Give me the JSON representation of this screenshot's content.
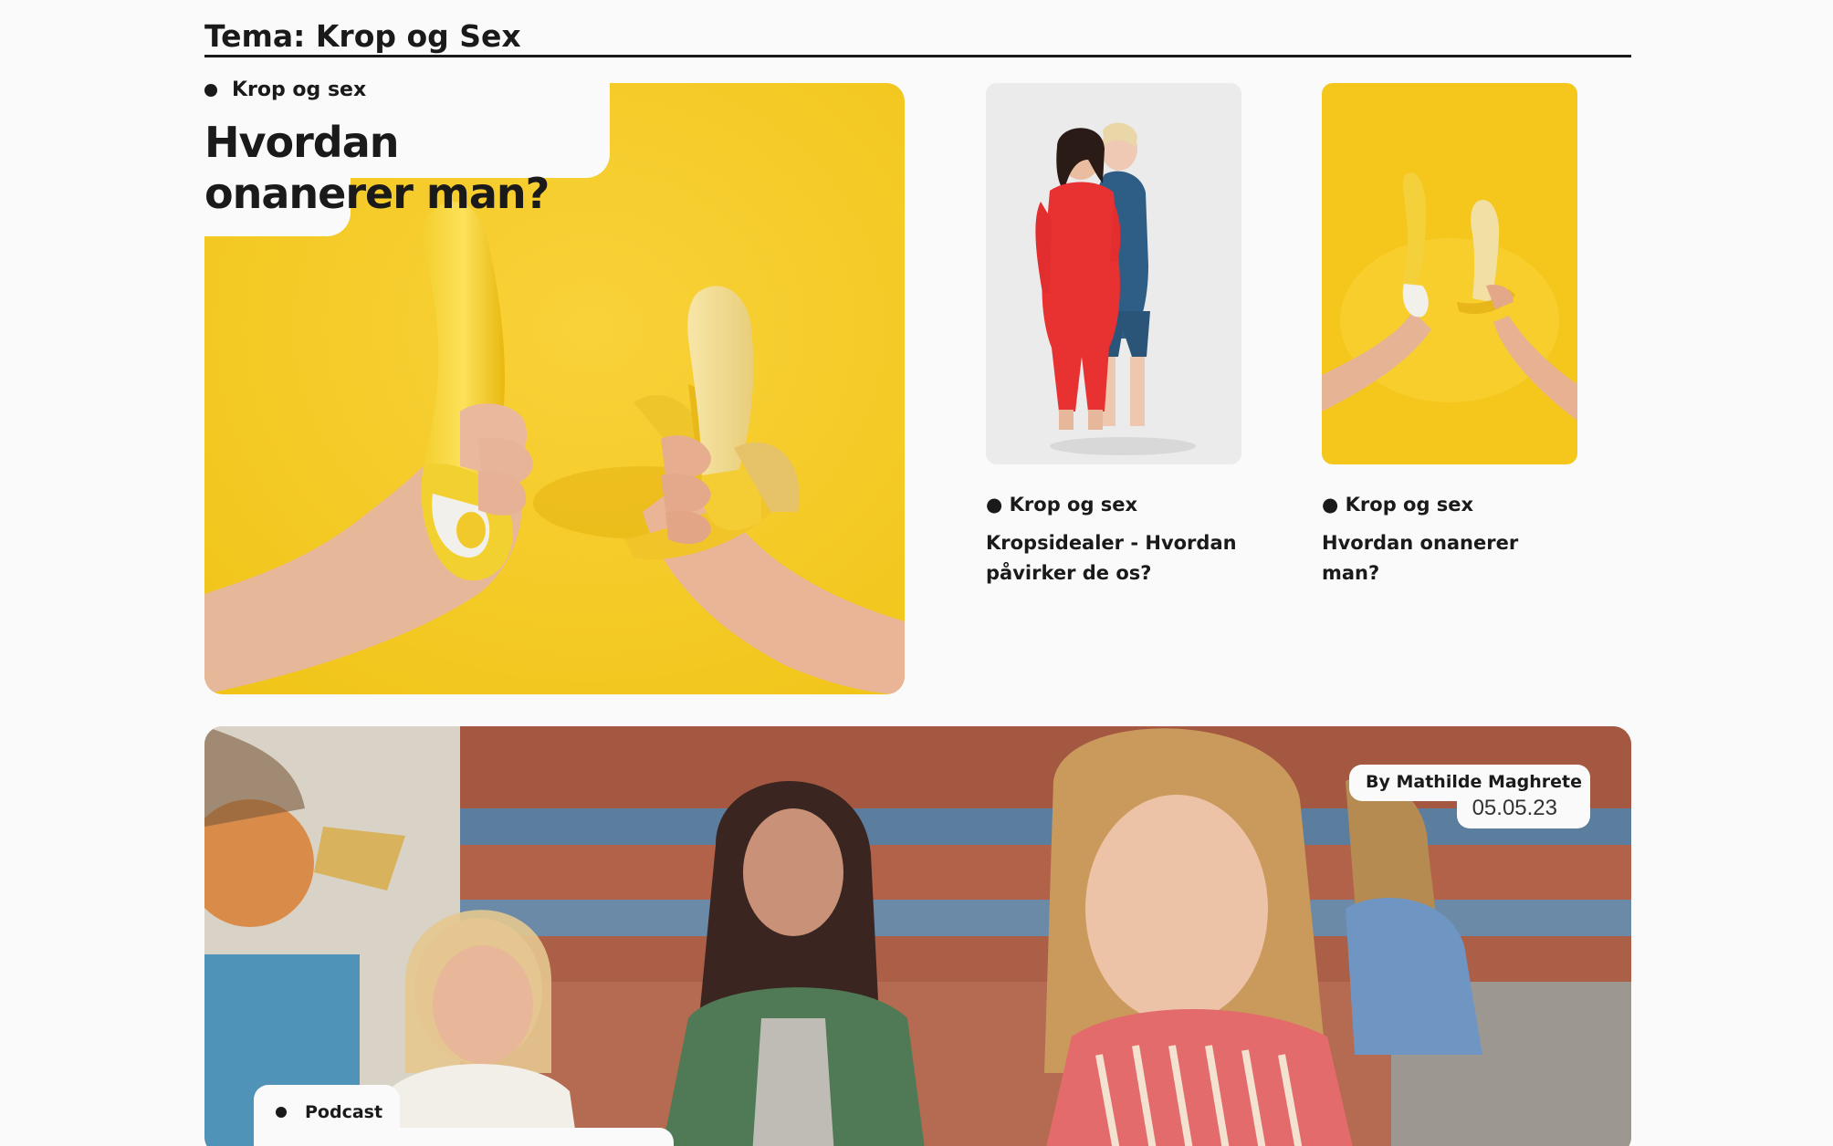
{
  "theme": {
    "title": "Tema: Krop og Sex"
  },
  "featured": {
    "category": "Krop og sex",
    "title": "Hvordan onanerer man?",
    "image": "banana-and-vibrator-yellow-photo"
  },
  "cards": [
    {
      "category": "● Krop og sex",
      "title": "Kropsidealer - Hvordan påvirker de os?",
      "image": "two-women-red-blue-outfits-photo"
    },
    {
      "category": "● Krop og sex",
      "title": "Hvordan onanerer man?",
      "image": "two-hands-banana-yellow-photo"
    }
  ],
  "hero": {
    "author": "By Mathilde Maghrete",
    "date": "05.05.23",
    "category": "Podcast",
    "image": "group-of-young-women-outdoors-photo"
  },
  "colors": {
    "background": "#fafafa",
    "text": "#1a1a1a",
    "yellow": "#f4c824"
  }
}
